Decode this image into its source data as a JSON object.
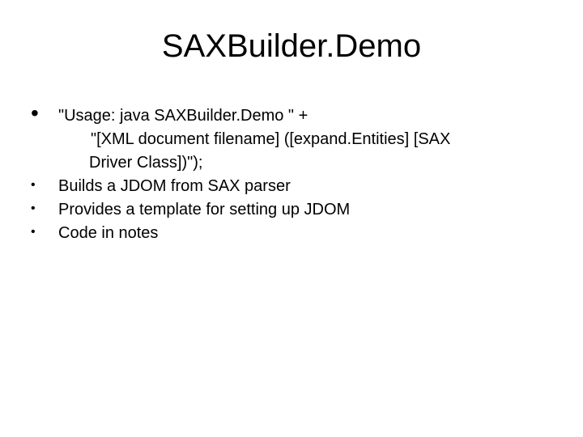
{
  "title": "SAXBuilder.Demo",
  "bullets": [
    {
      "style": "big",
      "text": " \"Usage: java SAXBuilder.Demo \" +"
    }
  ],
  "indent_line": "\"[XML document filename] ([expand.Entities] [SAX",
  "continuation": "Driver Class])\");",
  "small_bullets": [
    "Builds a JDOM from SAX parser",
    "Provides a template for setting up JDOM",
    "Code in notes"
  ]
}
